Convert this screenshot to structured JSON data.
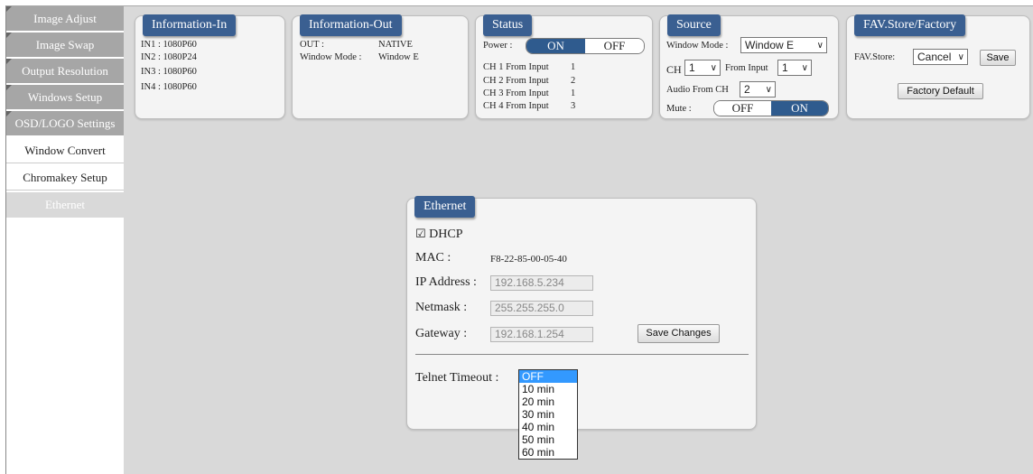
{
  "sidebar": {
    "items": [
      {
        "label": "Image Adjust"
      },
      {
        "label": "Image Swap"
      },
      {
        "label": "Output Resolution"
      },
      {
        "label": "Windows Setup"
      },
      {
        "label": "OSD/LOGO Settings"
      },
      {
        "label": "Window Convert"
      },
      {
        "label": "Chromakey Setup"
      },
      {
        "label": "Ethernet"
      }
    ]
  },
  "info_in": {
    "title": "Information-In",
    "lines": [
      "IN1 : 1080P60",
      "IN2 : 1080P24",
      "IN3 : 1080P60",
      "IN4 : 1080P60"
    ]
  },
  "info_out": {
    "title": "Information-Out",
    "out_label": "OUT :",
    "out_value": "NATIVE",
    "window_mode_label": "Window Mode :",
    "window_mode_value": "Window E"
  },
  "status": {
    "title": "Status",
    "power_label": "Power :",
    "power_on": "ON",
    "power_off": "OFF",
    "channels": [
      {
        "label": "CH 1 From Input",
        "value": "1"
      },
      {
        "label": "CH 2 From Input",
        "value": "2"
      },
      {
        "label": "CH 3 From Input",
        "value": "1"
      },
      {
        "label": "CH 4 From Input",
        "value": "3"
      }
    ]
  },
  "source": {
    "title": "Source",
    "window_mode_label": "Window Mode :",
    "window_mode_value": "Window E",
    "ch_label": "CH",
    "ch_value": "1",
    "from_input_label": "From Input",
    "from_input_value": "1",
    "audio_label": "Audio From CH",
    "audio_value": "2",
    "mute_label": "Mute :",
    "mute_off": "OFF",
    "mute_on": "ON"
  },
  "fav": {
    "title": "FAV.Store/Factory",
    "store_label": "FAV.Store:",
    "store_value": "Cancel",
    "save_label": "Save",
    "factory_label": "Factory Default"
  },
  "ethernet": {
    "title": "Ethernet",
    "dhcp_label": "DHCP",
    "mac_label": "MAC :",
    "mac_value": "F8-22-85-00-05-40",
    "ip_label": "IP Address :",
    "ip_value": "192.168.5.234",
    "netmask_label": "Netmask :",
    "netmask_value": "255.255.255.0",
    "gateway_label": "Gateway :",
    "gateway_value": "192.168.1.254",
    "save_changes_label": "Save Changes",
    "telnet_label": "Telnet Timeout :",
    "telnet_options": [
      "OFF",
      "10 min",
      "20 min",
      "30 min",
      "40 min",
      "50 min",
      "60 min"
    ]
  }
}
